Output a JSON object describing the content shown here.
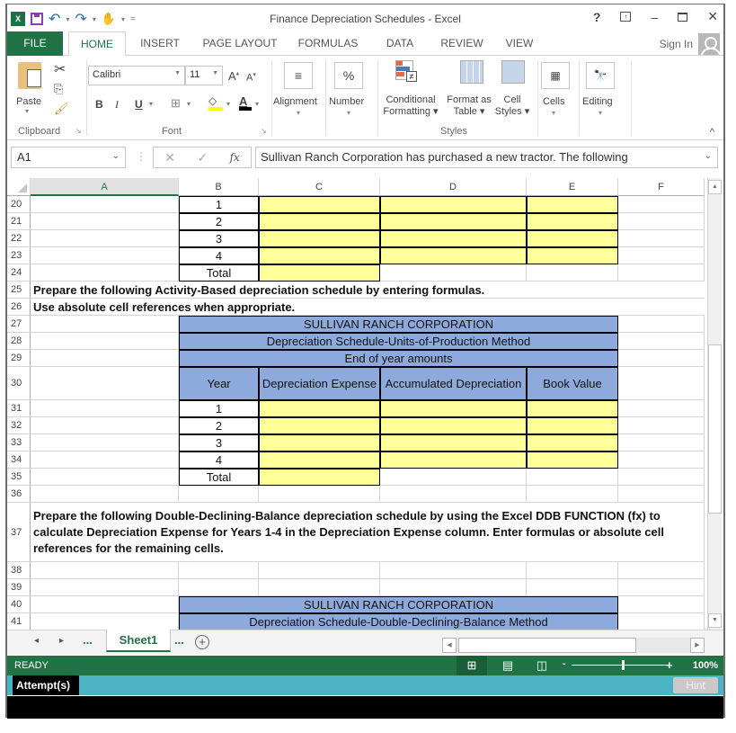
{
  "window": {
    "title": "Finance Depreciation Schedules - Excel",
    "controls": {
      "help": "?",
      "ribbon_display": "⌅",
      "minimize": "–",
      "restore": "🗗",
      "close": "✕"
    }
  },
  "quick_access": {
    "app_icon": "excel-logo",
    "save": "save-icon",
    "undo": "↶",
    "redo": "↷",
    "touch": "touch-mode-icon",
    "customize": "="
  },
  "tabs": [
    {
      "label": "FILE"
    },
    {
      "label": "HOME"
    },
    {
      "label": "INSERT"
    },
    {
      "label": "PAGE LAYOUT"
    },
    {
      "label": "FORMULAS"
    },
    {
      "label": "DATA"
    },
    {
      "label": "REVIEW"
    },
    {
      "label": "VIEW"
    }
  ],
  "active_tab": "HOME",
  "sign_in": "Sign In",
  "ribbon": {
    "clipboard": {
      "paste": "Paste",
      "group": "Clipboard"
    },
    "font": {
      "name": "Calibri",
      "size": "11",
      "bold": "B",
      "italic": "I",
      "underline": "U",
      "group": "Font"
    },
    "alignment": {
      "label": "Alignment"
    },
    "number": {
      "label": "Number",
      "icon": "%"
    },
    "styles": {
      "conditional": [
        "Conditional",
        "Formatting ▾"
      ],
      "format_table": [
        "Format as",
        "Table ▾"
      ],
      "cell_styles": [
        "Cell",
        "Styles ▾"
      ],
      "group": "Styles"
    },
    "cells": {
      "label": "Cells"
    },
    "editing": {
      "label": "Editing"
    }
  },
  "formula_bar": {
    "name_box": "A1",
    "cancel": "✕",
    "enter": "✓",
    "fx": "fx",
    "content": "Sullivan Ranch Corporation has purchased a new tractor.  The following"
  },
  "columns": [
    "A",
    "B",
    "C",
    "D",
    "E",
    "F"
  ],
  "selected_column": "A",
  "rows": {
    "r20": {
      "num": "20",
      "B": "1"
    },
    "r21": {
      "num": "21",
      "B": "2"
    },
    "r22": {
      "num": "22",
      "B": "3"
    },
    "r23": {
      "num": "23",
      "B": "4"
    },
    "r24": {
      "num": "24",
      "B": "Total"
    },
    "r25": {
      "num": "25",
      "A": "Prepare the following Activity-Based depreciation schedule by entering formulas."
    },
    "r26": {
      "num": "26",
      "A": "Use absolute cell references when appropriate."
    },
    "r27": {
      "num": "27",
      "B": "SULLIVAN RANCH CORPORATION"
    },
    "r28": {
      "num": "28",
      "B": "Depreciation Schedule-Units-of-Production Method"
    },
    "r29": {
      "num": "29",
      "B": "End of year amounts"
    },
    "r30": {
      "num": "30",
      "B": "Year",
      "C": "Depreciation Expense",
      "D": "Accumulated Depreciation",
      "E": "Book Value"
    },
    "r31": {
      "num": "31",
      "B": "1"
    },
    "r32": {
      "num": "32",
      "B": "2"
    },
    "r33": {
      "num": "33",
      "B": "3"
    },
    "r34": {
      "num": "34",
      "B": "4"
    },
    "r35": {
      "num": "35",
      "B": "Total"
    },
    "r36": {
      "num": "36"
    },
    "r37": {
      "num": "37",
      "A": "Prepare the following Double-Declining-Balance depreciation schedule by using the Excel DDB FUNCTION (fx) to calculate Depreciation Expense for Years 1-4 in the Depreciation Expense column. Enter formulas or absolute cell references for the remaining cells."
    },
    "r38": {
      "num": "38"
    },
    "r39": {
      "num": "39"
    },
    "r40": {
      "num": "40",
      "B": "SULLIVAN RANCH CORPORATION"
    },
    "r41": {
      "num": "41",
      "B": "Depreciation Schedule-Double-Declining-Balance Method"
    }
  },
  "sheet_tabs": {
    "prev": "◂",
    "next": "▸",
    "more_left": "...",
    "active": "Sheet1",
    "more_right": "...",
    "add": "+"
  },
  "status_bar": {
    "mode": "READY",
    "zoom_minus": "-",
    "zoom_plus": "+",
    "zoom": "100%",
    "zoom_level_percent": 100
  },
  "attempt_bar": {
    "label": "Attempt(s)",
    "hint": "Hint"
  },
  "colors": {
    "excel_green": "#217346",
    "header_blue": "#8ea9db",
    "input_yellow": "#ffff99",
    "attempt_teal": "#4bb3c4"
  }
}
